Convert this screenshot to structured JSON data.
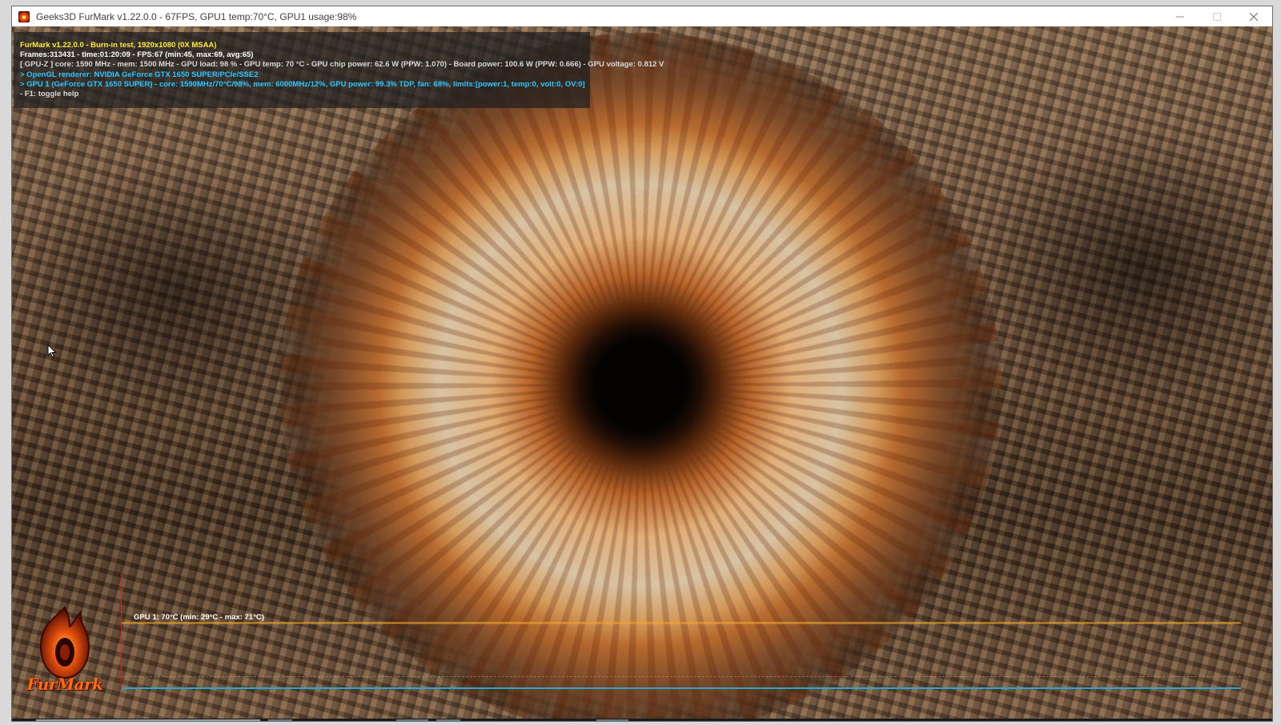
{
  "window": {
    "title": "Geeks3D FurMark v1.22.0.0 - 67FPS, GPU1 temp:70°C, GPU1 usage:98%"
  },
  "overlay": {
    "line1": "FurMark v1.22.0.0 - Burn-in test, 1920x1080 (0X MSAA)",
    "line2": "Frames:313431 - time:01:20:09 - FPS:67 (min:45, max:69, avg:65)",
    "line3": "[ GPU-Z ] core: 1590 MHz - mem: 1500 MHz - GPU load: 98 % - GPU temp: 70 °C - GPU chip power: 62.6 W (PPW: 1.070) - Board power: 100.6 W (PPW: 0.666) - GPU voltage: 0.812 V",
    "line4": "> OpenGL renderer: NVIDIA GeForce GTX 1650 SUPER/PCIe/SSE2",
    "line5": "> GPU 1 (GeForce GTX 1650 SUPER) - core: 1590MHz/70°C/98%, mem: 6000MHz/12%, GPU power: 99.3% TDP, fan: 68%, limits:[power:1, temp:0, volt:0, OV:0]",
    "line6": "- F1: toggle help"
  },
  "graph": {
    "label": "GPU 1: 70°C (min: 29°C - max: 71°C)"
  },
  "logo": {
    "text": "FurMark"
  },
  "icons": {
    "app": "furmark-app-icon",
    "minimize": "minimize-icon",
    "maximize": "maximize-icon",
    "close": "close-icon",
    "cursor": "mouse-pointer-icon"
  },
  "colors": {
    "overlay_yellow": "#ffeb3b",
    "overlay_cyan": "#2ec7ff",
    "graph_temperature": "#f0a020",
    "graph_axis": "#d92020",
    "graph_baseline": "#2aa7c9"
  }
}
